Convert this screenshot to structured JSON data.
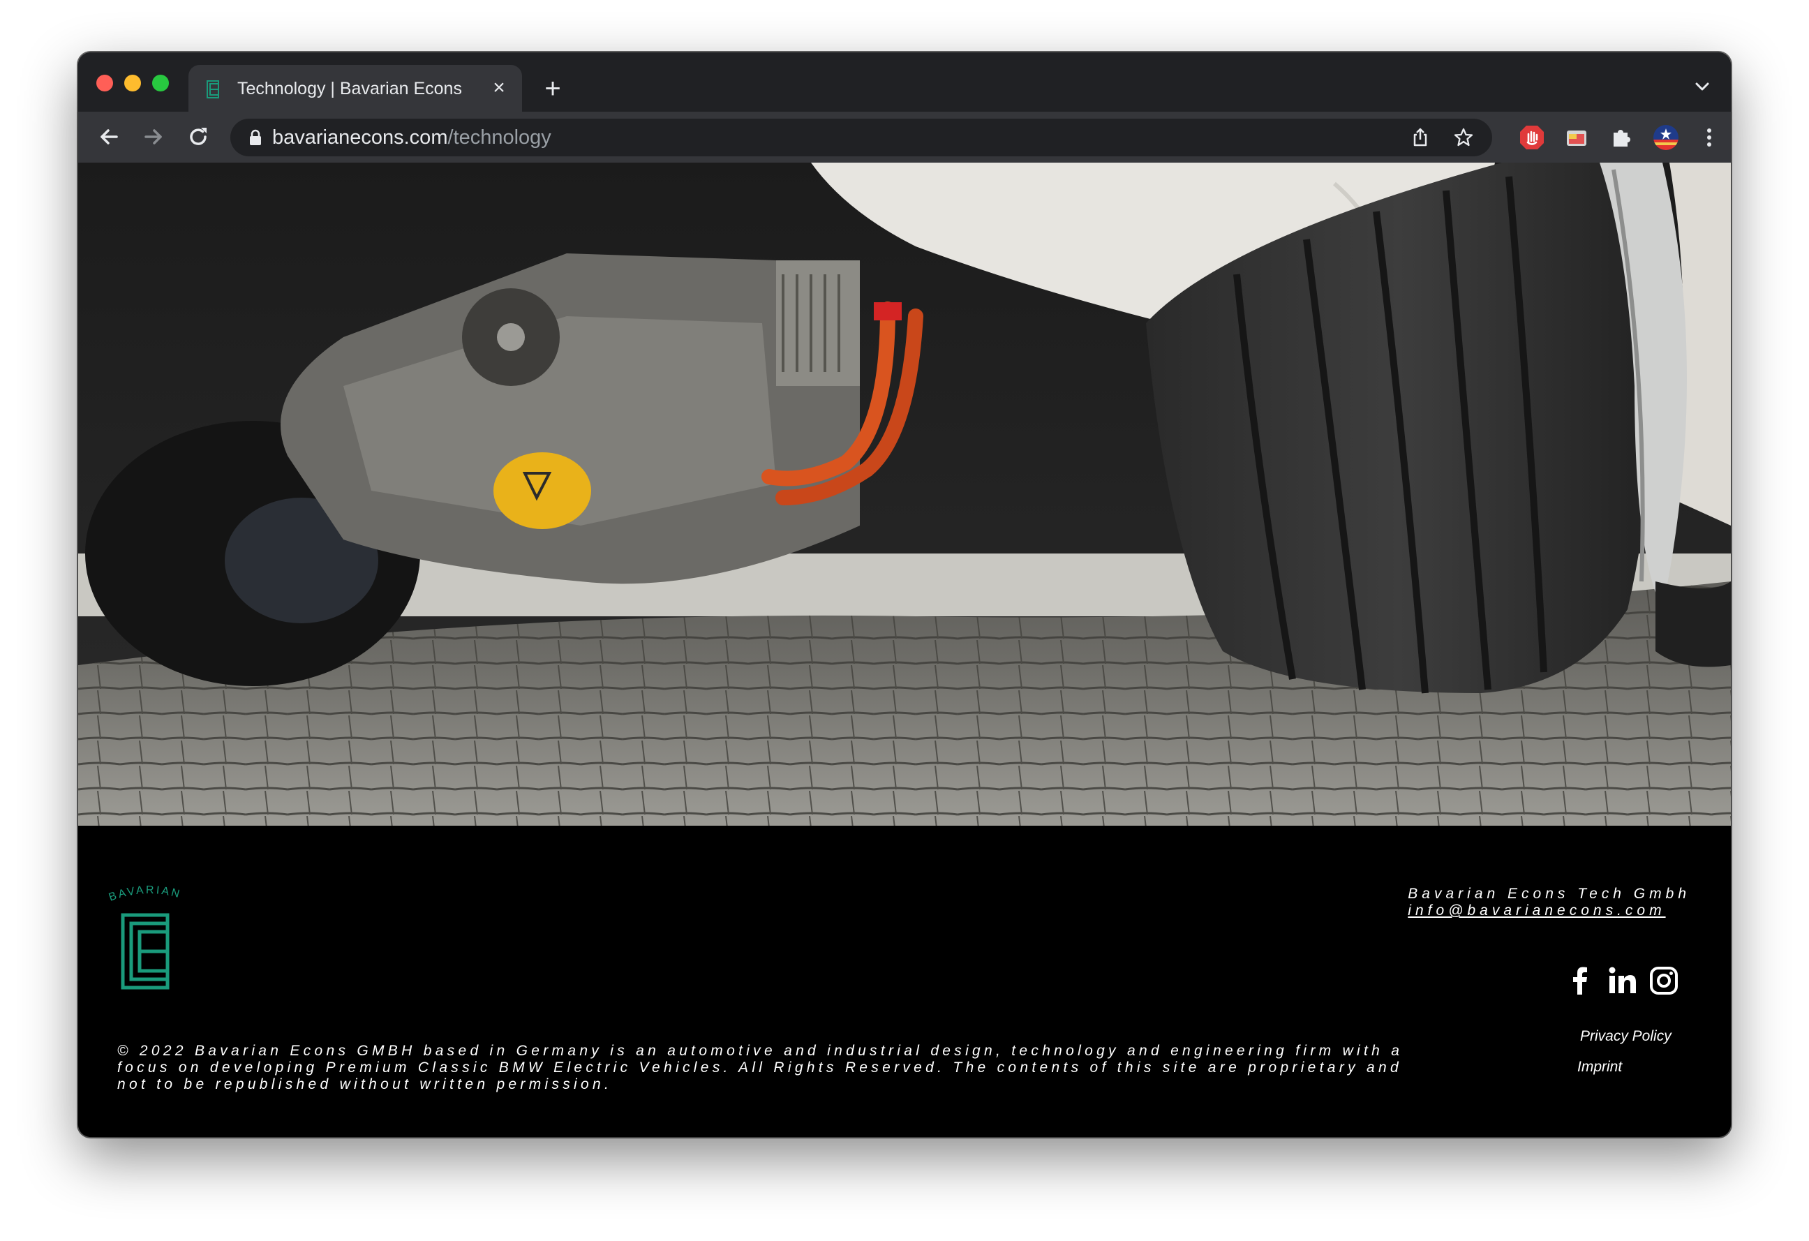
{
  "browser": {
    "tab_title": "Technology | Bavarian Econs",
    "close_glyph": "×",
    "new_tab_glyph": "+",
    "url_host": "bavarianecons.com",
    "url_path": "/technology"
  },
  "hero": {
    "image": "photo of the underside of a white classic car showing an electric motor with orange cables and a tire on cobblestone"
  },
  "footer": {
    "logo_text": "BAVARIAN",
    "company_name": "Bavarian Econs Tech Gmbh",
    "email": "info@bavarianecons.com",
    "social_icons": [
      "facebook-icon",
      "linkedin-icon",
      "instagram-icon"
    ],
    "privacy_label": "Privacy Policy",
    "imprint_label": "Imprint",
    "copyright": "© 2022 Bavarian Econs GMBH based in Germany is an automotive and industrial design, technology and engineering firm with a focus on developing Premium Classic BMW Electric Vehicles. All Rights Reserved. The contents of this site are proprietary and not to be republished without written permission."
  },
  "colors": {
    "brand_green": "#1a9b7c",
    "footer_bg": "#000000",
    "chrome_dark": "#202124",
    "chrome_tab": "#35363a"
  }
}
